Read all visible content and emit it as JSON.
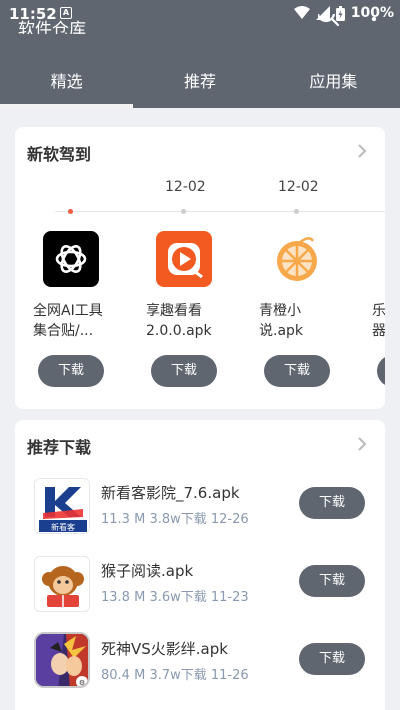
{
  "status": {
    "time": "11:52",
    "battery": "100%",
    "a_badge": "A"
  },
  "header": {
    "title": "软件仓库"
  },
  "tabs": [
    {
      "label": "精选",
      "active": true
    },
    {
      "label": "推荐",
      "active": false
    },
    {
      "label": "应用集",
      "active": false
    }
  ],
  "new_section": {
    "title": "新软驾到",
    "dates": [
      "12-02",
      "12-02"
    ],
    "apps": [
      {
        "name": "全网AI工具集合贴/...",
        "button": "下载",
        "icon": "openai-logo-icon"
      },
      {
        "name": "享趣看看2.0.0.apk",
        "button": "下载",
        "icon": "play-icon"
      },
      {
        "name": "青橙小说.apk",
        "button": "下载",
        "icon": "orange-slice-icon"
      },
      {
        "name": "乐器",
        "button": "",
        "icon": ""
      }
    ]
  },
  "rec_section": {
    "title": "推荐下载",
    "items": [
      {
        "name": "新看客影院_7.6.apk",
        "size": "11.3 M",
        "downloads": "3.8w下载",
        "date": "12-26",
        "button": "下载",
        "icon": "k-logo-icon"
      },
      {
        "name": "猴子阅读.apk",
        "size": "13.8 M",
        "downloads": "3.6w下载",
        "date": "11-23",
        "button": "下载",
        "icon": "monkey-icon"
      },
      {
        "name": "死神VS火影绊.apk",
        "size": "80.4 M",
        "downloads": "3.7w下载",
        "date": "11-26",
        "button": "下载",
        "icon": "anime-character-icon"
      }
    ]
  },
  "colors": {
    "header": "#5f6670",
    "accent_dot": "#f05a40",
    "meta": "#8a99b0"
  }
}
